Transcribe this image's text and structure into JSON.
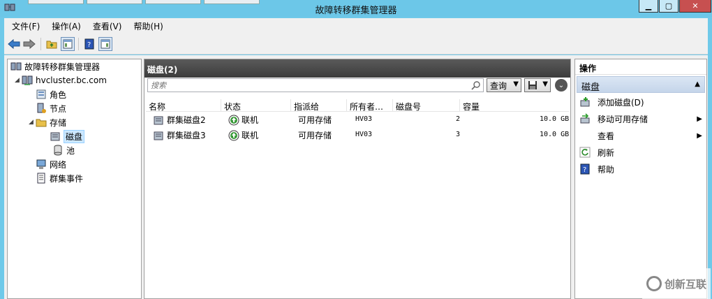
{
  "window": {
    "title": "故障转移群集管理器",
    "min": "▁",
    "max": "▢",
    "close": "✕"
  },
  "menu": [
    "文件(F)",
    "操作(A)",
    "查看(V)",
    "帮助(H)"
  ],
  "tree": {
    "root": "故障转移群集管理器",
    "cluster": "hvcluster.bc.com",
    "roles": "角色",
    "nodes": "节点",
    "storage": "存储",
    "disks": "磁盘",
    "pools": "池",
    "networks": "网络",
    "events": "群集事件"
  },
  "center": {
    "header": "磁盘(2)",
    "search_placeholder": "搜索",
    "query_label": "查询",
    "columns": [
      "名称",
      "状态",
      "指派给",
      "所有者…",
      "磁盘号",
      "容量"
    ],
    "rows": [
      {
        "name": "群集磁盘2",
        "status": "联机",
        "assigned": "可用存储",
        "owner": "HV03",
        "disk_no": "2",
        "capacity": "10.0 GB"
      },
      {
        "name": "群集磁盘3",
        "status": "联机",
        "assigned": "可用存储",
        "owner": "HV03",
        "disk_no": "3",
        "capacity": "10.0 GB"
      }
    ]
  },
  "actions": {
    "title": "操作",
    "section": "磁盘",
    "items": [
      {
        "label": "添加磁盘(D)",
        "submenu": false
      },
      {
        "label": "移动可用存储",
        "submenu": true
      },
      {
        "label": "查看",
        "submenu": true
      },
      {
        "label": "刷新",
        "submenu": false
      },
      {
        "label": "帮助",
        "submenu": false
      }
    ]
  },
  "watermark": "创新互联",
  "colors": {
    "titlebar": "#6cc7e8",
    "close": "#c75050",
    "header": "#3c3c3c",
    "section": "#c5d5ea"
  }
}
